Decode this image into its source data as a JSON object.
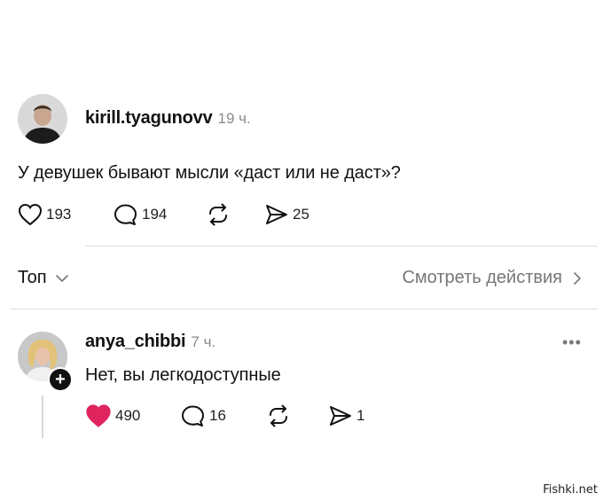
{
  "post": {
    "username": "kirill.tyagunovv",
    "time": "19 ч.",
    "text": "У девушек бывают мысли «даст или не даст»?",
    "likes": "193",
    "comments": "194",
    "shares": "25"
  },
  "sort_bar": {
    "sort_label": "Топ",
    "activity_label": "Смотреть действия"
  },
  "reply": {
    "username": "anya_chibbi",
    "time": "7 ч.",
    "text": "Нет, вы легкодоступные",
    "likes": "490",
    "comments": "16",
    "shares": "1",
    "liked": true
  },
  "watermark": "Fishki.net",
  "colors": {
    "like_active": "#e0245e",
    "muted": "#8a8a8a",
    "divider": "#dedede"
  }
}
